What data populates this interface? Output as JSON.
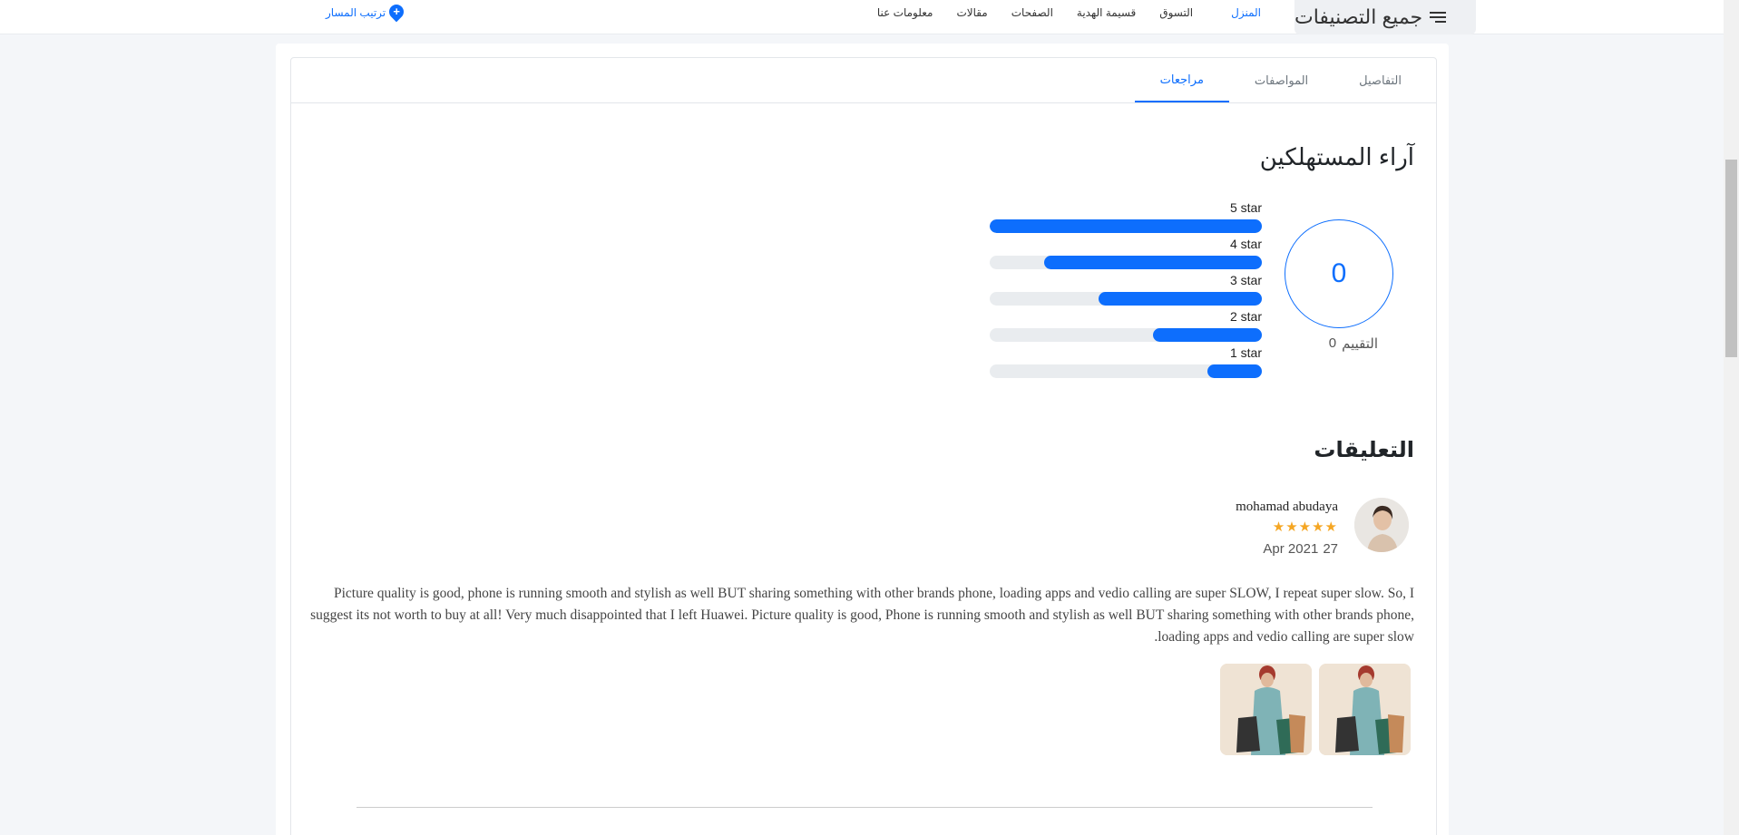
{
  "nav": {
    "categories_label": "جميع التصنيفات",
    "links": [
      "المنزل",
      "التسوق",
      "قسيمة الهدية",
      "الصفحات",
      "مقالات",
      "معلومات عنا"
    ],
    "track_label": "ترتيب المسار"
  },
  "tabs": [
    "التفاصيل",
    "المواصفات",
    "مراجعات"
  ],
  "active_tab": "مراجعات",
  "reviews": {
    "title": "آراء المستهلكين",
    "average": "0",
    "rating_count": "0",
    "rating_label": "التقييم",
    "bars": [
      {
        "label": "5 star",
        "percent": 100
      },
      {
        "label": "4 star",
        "percent": 80
      },
      {
        "label": "3 star",
        "percent": 60
      },
      {
        "label": "2 star",
        "percent": 40
      },
      {
        "label": "1 star",
        "percent": 20
      }
    ]
  },
  "comments": {
    "title": "التعليقات",
    "items": [
      {
        "name": "mohamad abudaya",
        "stars": "★★★★★",
        "rating": 5,
        "date_day": "27",
        "date_rest": "Apr 2021",
        "text": "Picture quality is good, phone is running smooth and stylish as well BUT sharing something with other brands phone, loading apps and vedio calling are super SLOW, I repeat super slow. So, I suggest its not worth to buy at all! Very much disappointed that I left Huawei. Picture quality is good, Phone is running smooth and stylish as well BUT sharing something with other brands phone, loading apps and vedio calling are super slow."
      }
    ]
  },
  "colors": {
    "accent": "#0d6efd",
    "star": "#f5a623",
    "track": "#e9ecef"
  }
}
